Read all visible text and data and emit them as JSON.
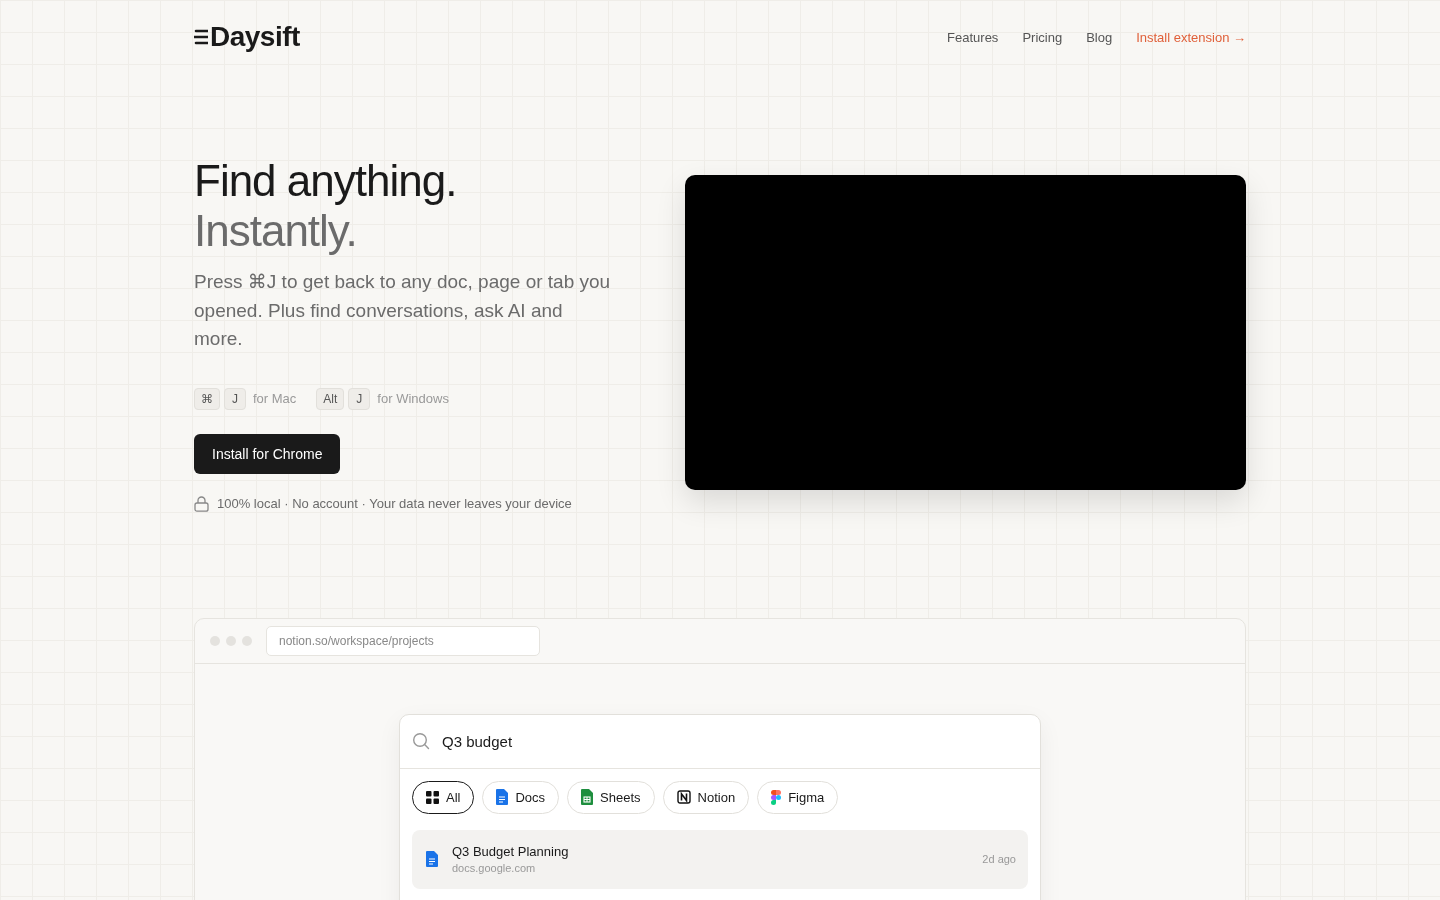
{
  "brand": {
    "name": "Daysift"
  },
  "nav": {
    "links": [
      {
        "label": "Features",
        "kind": "plain"
      },
      {
        "label": "Pricing",
        "kind": "plain"
      },
      {
        "label": "Blog",
        "kind": "plain"
      },
      {
        "label": "Install extension →",
        "kind": "accent"
      }
    ]
  },
  "hero": {
    "title": "Find anything.",
    "subtitle": "Instantly.",
    "description": "Press ⌘J to get back to any doc, page or tab you opened. Plus find conversations, ask AI and more.",
    "shortcuts": [
      {
        "keys": [
          "⌘",
          "J"
        ],
        "label": "for Mac"
      },
      {
        "keys": [
          "Alt",
          "J"
        ],
        "label": "for Windows"
      }
    ],
    "cta": "Install for Chrome",
    "privacy_note": "100% local · No account · Your data never leaves your device"
  },
  "video": {
    "kind": "video"
  },
  "demo": {
    "address": "notion.so/workspace/projects",
    "search_value": "Q3 budget",
    "filters": [
      {
        "label": "All",
        "kind": "all",
        "selected": true
      },
      {
        "label": "Docs",
        "kind": "docs",
        "selected": false
      },
      {
        "label": "Sheets",
        "kind": "sheets",
        "selected": false
      },
      {
        "label": "Notion",
        "kind": "notion",
        "selected": false
      },
      {
        "label": "Figma",
        "kind": "figma",
        "selected": false
      }
    ],
    "results": [
      {
        "title": "Q3 Budget Planning",
        "url": "docs.google.com",
        "time": "2d ago",
        "kind": "docs",
        "selected": true
      }
    ]
  }
}
